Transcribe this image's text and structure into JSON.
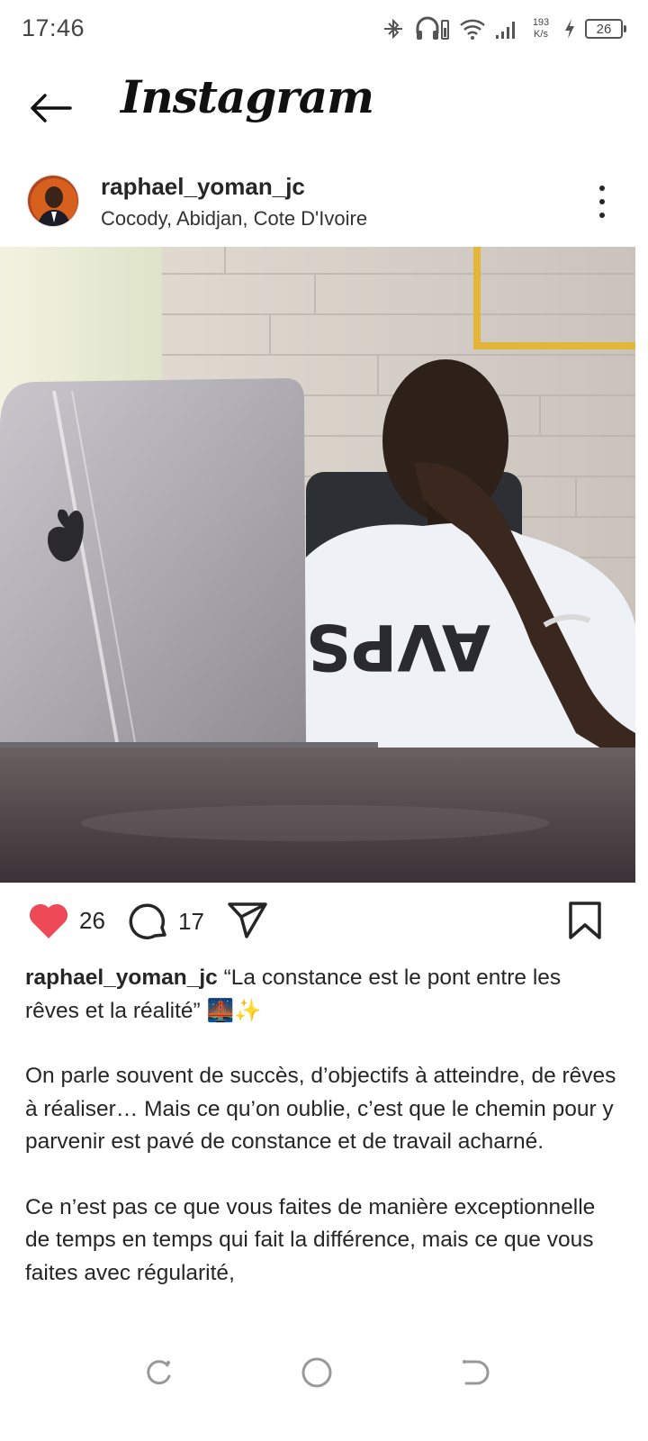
{
  "status_bar": {
    "time": "17:46",
    "net_speed_value": "193",
    "net_speed_unit": "K/s",
    "battery": "26",
    "icons": [
      "bluetooth-off-icon",
      "headset-battery-icon",
      "wifi-icon",
      "signal-icon",
      "charging-icon",
      "battery-icon"
    ]
  },
  "header": {
    "brand": "Instagram",
    "back_icon": "arrow-left-icon"
  },
  "post": {
    "username": "raphael_yoman_jc",
    "location": "Cocody, Abidjan, Cote D'Ivoire",
    "likes": "26",
    "comments": "17",
    "caption_line1": " “La constance est le pont entre les rêves et la réalité” 🌉✨",
    "caption_p2": "On parle souvent de succès, d’objectifs à atteindre, de rêves à réaliser… Mais ce qu’on oublie, c’est que le chemin pour y parvenir est pavé de constance et de travail acharné.",
    "caption_p3": "Ce n’est pas ce que vous faites de manière exceptionnelle de temps en temps qui fait la différence, mais ce que vous faites avec régularité,",
    "photo_tshirt_text": "AVPS"
  },
  "colors": {
    "like_red": "#ed4956",
    "text": "#262626"
  }
}
